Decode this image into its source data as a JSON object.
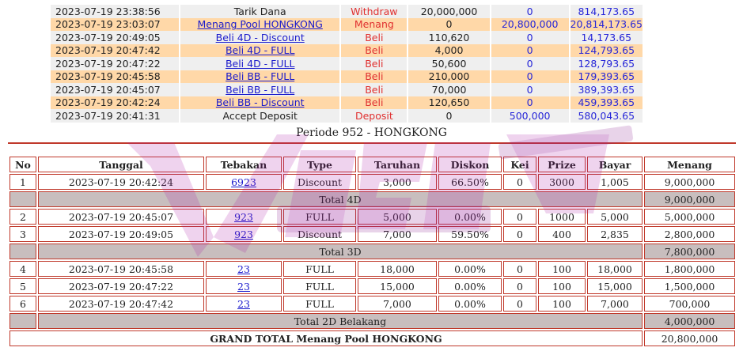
{
  "transactions": [
    {
      "date": "2023-07-19 23:38:56",
      "desc": "Tarik Dana",
      "link": false,
      "type": "Withdraw",
      "amount": "20,000,000",
      "in": "0",
      "balance": "814,173.65"
    },
    {
      "date": "2023-07-19 23:03:07",
      "desc": "Menang Pool HONGKONG",
      "link": true,
      "type": "Menang",
      "amount": "0",
      "in": "20,800,000",
      "balance": "20,814,173.65"
    },
    {
      "date": "2023-07-19 20:49:05",
      "desc": "Beli 4D - Discount",
      "link": true,
      "type": "Beli",
      "amount": "110,620",
      "in": "0",
      "balance": "14,173.65"
    },
    {
      "date": "2023-07-19 20:47:42",
      "desc": "Beli 4D - FULL",
      "link": true,
      "type": "Beli",
      "amount": "4,000",
      "in": "0",
      "balance": "124,793.65"
    },
    {
      "date": "2023-07-19 20:47:22",
      "desc": "Beli 4D - FULL",
      "link": true,
      "type": "Beli",
      "amount": "50,600",
      "in": "0",
      "balance": "128,793.65"
    },
    {
      "date": "2023-07-19 20:45:58",
      "desc": "Beli BB - FULL",
      "link": true,
      "type": "Beli",
      "amount": "210,000",
      "in": "0",
      "balance": "179,393.65"
    },
    {
      "date": "2023-07-19 20:45:07",
      "desc": "Beli BB - FULL",
      "link": true,
      "type": "Beli",
      "amount": "70,000",
      "in": "0",
      "balance": "389,393.65"
    },
    {
      "date": "2023-07-19 20:42:24",
      "desc": "Beli BB - Discount",
      "link": true,
      "type": "Beli",
      "amount": "120,650",
      "in": "0",
      "balance": "459,393.65"
    },
    {
      "date": "2023-07-19 20:41:31",
      "desc": "Accept Deposit",
      "link": false,
      "type": "Deposit",
      "amount": "0",
      "in": "500,000",
      "balance": "580,043.65"
    }
  ],
  "period_title": "Periode 952 - HONGKONG",
  "bet_headers": [
    "No",
    "Tanggal",
    "Tebakan",
    "Type",
    "Taruhan",
    "Diskon",
    "Kei",
    "Prize",
    "Bayar",
    "Menang"
  ],
  "bet_rows": [
    {
      "kind": "row",
      "no": "1",
      "date": "2023-07-19 20:42:24",
      "guess": "6923",
      "type": "Discount",
      "bet": "3,000",
      "disc": "66.50%",
      "kei": "0",
      "prize": "3000",
      "pay": "1,005",
      "win": "9,000,000"
    },
    {
      "kind": "subtotal",
      "label": "Total 4D",
      "win": "9,000,000"
    },
    {
      "kind": "row",
      "no": "2",
      "date": "2023-07-19 20:45:07",
      "guess": "923",
      "type": "FULL",
      "bet": "5,000",
      "disc": "0.00%",
      "kei": "0",
      "prize": "1000",
      "pay": "5,000",
      "win": "5,000,000"
    },
    {
      "kind": "row",
      "no": "3",
      "date": "2023-07-19 20:49:05",
      "guess": "923",
      "type": "Discount",
      "bet": "7,000",
      "disc": "59.50%",
      "kei": "0",
      "prize": "400",
      "pay": "2,835",
      "win": "2,800,000"
    },
    {
      "kind": "subtotal",
      "label": "Total 3D",
      "win": "7,800,000"
    },
    {
      "kind": "row",
      "no": "4",
      "date": "2023-07-19 20:45:58",
      "guess": "23",
      "type": "FULL",
      "bet": "18,000",
      "disc": "0.00%",
      "kei": "0",
      "prize": "100",
      "pay": "18,000",
      "win": "1,800,000"
    },
    {
      "kind": "row",
      "no": "5",
      "date": "2023-07-19 20:47:22",
      "guess": "23",
      "type": "FULL",
      "bet": "15,000",
      "disc": "0.00%",
      "kei": "0",
      "prize": "100",
      "pay": "15,000",
      "win": "1,500,000"
    },
    {
      "kind": "row",
      "no": "6",
      "date": "2023-07-19 20:47:42",
      "guess": "23",
      "type": "FULL",
      "bet": "7,000",
      "disc": "0.00%",
      "kei": "0",
      "prize": "100",
      "pay": "7,000",
      "win": "700,000"
    },
    {
      "kind": "subtotal",
      "label": "Total 2D Belakang",
      "win": "4,000,000"
    },
    {
      "kind": "grand",
      "label": "GRAND TOTAL  Menang Pool HONGKONG",
      "win": "20,800,000"
    }
  ],
  "watermark": {
    "icon": "brand-logo-watermark",
    "color": "#b01fa8"
  }
}
